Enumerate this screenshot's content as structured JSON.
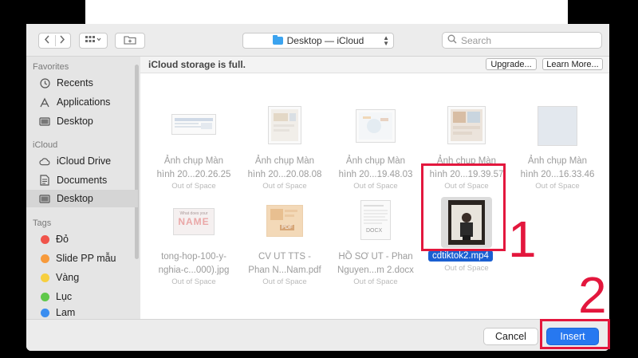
{
  "toolbar": {
    "back_icon": "chevron-left-icon",
    "forward_icon": "chevron-right-icon",
    "view_icon": "grid-view-icon",
    "new_folder_icon": "new-folder-icon",
    "location": "Desktop — iCloud",
    "search_placeholder": "Search"
  },
  "sidebar": {
    "favorites_header": "Favorites",
    "favorites": [
      {
        "label": "Recents",
        "icon": "clock-icon"
      },
      {
        "label": "Applications",
        "icon": "applications-icon"
      },
      {
        "label": "Desktop",
        "icon": "desktop-icon"
      }
    ],
    "icloud_header": "iCloud",
    "icloud": [
      {
        "label": "iCloud Drive",
        "icon": "cloud-icon"
      },
      {
        "label": "Documents",
        "icon": "document-icon"
      },
      {
        "label": "Desktop",
        "icon": "desktop-icon",
        "selected": true
      }
    ],
    "tags_header": "Tags",
    "tags": [
      {
        "label": "Đỏ",
        "color": "#f0544b"
      },
      {
        "label": "Slide PP mẫu",
        "color": "#f79a3b"
      },
      {
        "label": "Vàng",
        "color": "#f7cf3f"
      },
      {
        "label": "Lục",
        "color": "#5fc84a"
      },
      {
        "label": "Lam",
        "color": "#3b8ef0"
      }
    ]
  },
  "banner": {
    "text": "iCloud storage is full.",
    "upgrade_label": "Upgrade...",
    "learn_more_label": "Learn More..."
  },
  "files": [
    {
      "line1": "Ảnh chụp Màn",
      "line2": "hình 20...20.26.25",
      "status": "Out of Space"
    },
    {
      "line1": "Ảnh chụp Màn",
      "line2": "hình 20...20.08.08",
      "status": "Out of Space"
    },
    {
      "line1": "Ảnh chụp Màn",
      "line2": "hình 20...19.48.03",
      "status": "Out of Space"
    },
    {
      "line1": "Ảnh chụp Màn",
      "line2": "hình 20...19.39.57",
      "status": "Out of Space"
    },
    {
      "line1": "Ảnh chụp Màn",
      "line2": "hình 20...16.33.46",
      "status": "Out of Space"
    },
    {
      "line1": "tong-hop-100-y-",
      "line2": "nghia-c...000).jpg",
      "status": "Out of Space"
    },
    {
      "line1": "CV UT TTS -",
      "line2": "Phan N...Nam.pdf",
      "status": "Out of Space"
    },
    {
      "line1": "HỒ SƠ UT - Phan",
      "line2": "Nguyen...m 2.docx",
      "status": "Out of Space"
    },
    {
      "line1": "cdtiktok2.mp4",
      "line2": "",
      "status": "Out of Space",
      "selected": true
    }
  ],
  "thumb_texts": {
    "name_thumb_top": "What does your",
    "name_thumb_big": "NAME",
    "pdf_badge": "PDF",
    "docx_badge": "DOCX"
  },
  "annotations": {
    "marker1": "1",
    "marker2": "2",
    "color": "#e3173d"
  },
  "footer": {
    "cancel_label": "Cancel",
    "insert_label": "Insert"
  }
}
